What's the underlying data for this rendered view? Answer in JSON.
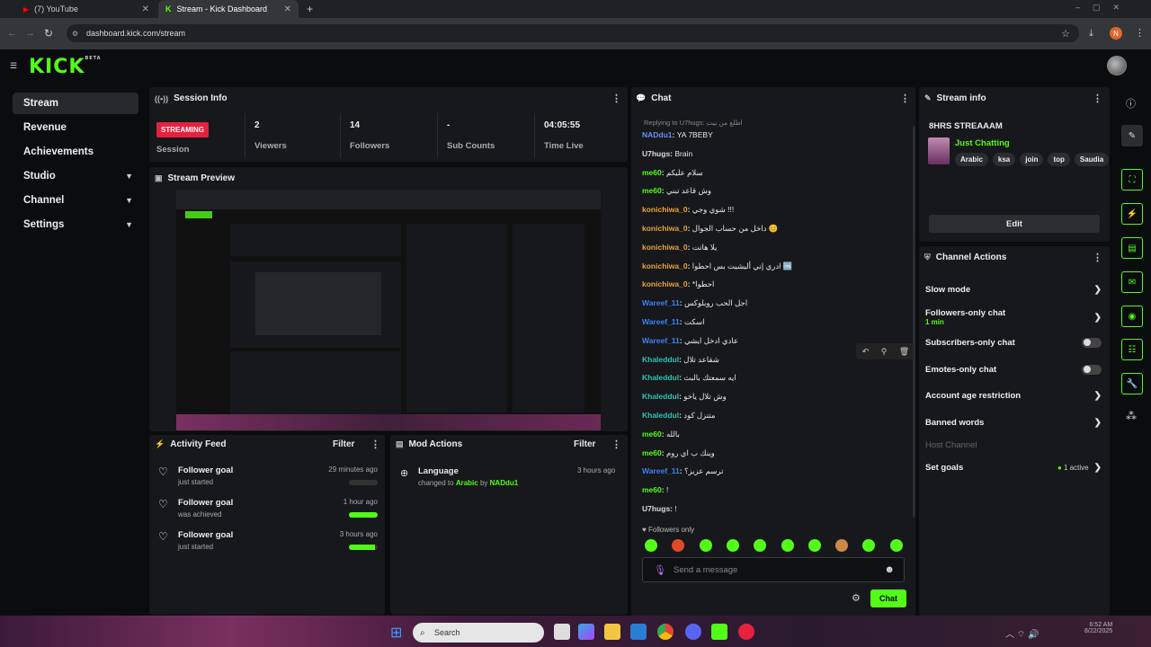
{
  "browser": {
    "tabs": [
      {
        "title": "(7) YouTube"
      },
      {
        "title": "Stream - Kick Dashboard"
      }
    ],
    "url": "dashboard.kick.com/stream",
    "profile_initial": "N"
  },
  "app": {
    "logo": "KICK",
    "logo_badge": "BETA"
  },
  "sidebar": {
    "items": [
      {
        "label": "Stream"
      },
      {
        "label": "Revenue"
      },
      {
        "label": "Achievements"
      },
      {
        "label": "Studio"
      },
      {
        "label": "Channel"
      },
      {
        "label": "Settings"
      }
    ]
  },
  "session": {
    "title": "Session Info",
    "status": "STREAMING",
    "status_label": "Session",
    "stats": [
      {
        "value": "2",
        "label": "Viewers"
      },
      {
        "value": "14",
        "label": "Followers"
      },
      {
        "value": "-",
        "label": "Sub Counts"
      },
      {
        "value": "04:05:55",
        "label": "Time Live"
      }
    ]
  },
  "preview": {
    "title": "Stream Preview"
  },
  "activity": {
    "title": "Activity Feed",
    "filter": "Filter",
    "items": [
      {
        "title": "Follower goal",
        "sub": "just started",
        "ago": "29 minutes ago",
        "progress": 0
      },
      {
        "title": "Follower goal",
        "sub": "was achieved",
        "ago": "1 hour ago",
        "progress": 1
      },
      {
        "title": "Follower goal",
        "sub": "just started",
        "ago": "3 hours ago",
        "progress": 0.9
      }
    ]
  },
  "mod": {
    "title": "Mod Actions",
    "filter": "Filter",
    "item": {
      "title": "Language",
      "prefix": "changed to",
      "lang": "Arabic",
      "by": "by",
      "user": "NADdu1",
      "ago": "3 hours ago"
    }
  },
  "chat": {
    "title": "Chat",
    "reply_to": "Replying to U7hugs: اطلع من بيت",
    "messages": [
      {
        "user": "NADdu1",
        "text": "YA 7BEBY",
        "color": "#6c8cff"
      },
      {
        "user": "U7hugs",
        "text": "Brain",
        "color": "#dddddd"
      },
      {
        "user": "me60",
        "text": "سلام عليكم",
        "color": "#53fc18"
      },
      {
        "user": "me60",
        "text": "وش قاعد تبني",
        "color": "#53fc18"
      },
      {
        "user": "konichiwa_0",
        "text": "شوي وجي !!!",
        "color": "#e8a33c"
      },
      {
        "user": "konichiwa_0",
        "text": "داخل من حساب الجوال 😊",
        "color": "#e8a33c"
      },
      {
        "user": "konichiwa_0",
        "text": "يلا هاتت",
        "color": "#e8a33c"
      },
      {
        "user": "konichiwa_0",
        "text": "ادري إني أليشيت بس احطوا 🆒",
        "color": "#e8a33c"
      },
      {
        "user": "konichiwa_0",
        "text": "*احطوا",
        "color": "#e8a33c"
      },
      {
        "user": "Wareef_11",
        "text": "اجل الحب روبلوكس",
        "color": "#3b82f6"
      },
      {
        "user": "Wareef_11",
        "text": "اسكت",
        "color": "#3b82f6"
      },
      {
        "user": "Wareef_11",
        "text": "عادي ادخل ايشي",
        "color": "#3b82f6"
      },
      {
        "user": "Khaleddul",
        "text": "شقاعد تلال",
        "color": "#2ec4b6"
      },
      {
        "user": "Khaleddul",
        "text": "ايه سمعتك بالبث",
        "color": "#2ec4b6"
      },
      {
        "user": "Khaleddul",
        "text": "وش تلال ياخو",
        "color": "#2ec4b6"
      },
      {
        "user": "Khaleddul",
        "text": "متنزل كود",
        "color": "#2ec4b6"
      },
      {
        "user": "me60",
        "text": "بالله",
        "color": "#53fc18"
      },
      {
        "user": "me60",
        "text": "وينك ب اي روم",
        "color": "#53fc18"
      },
      {
        "user": "Wareef_11",
        "text": "ترسم عزيز؟",
        "color": "#3b82f6"
      },
      {
        "user": "me60",
        "text": "!",
        "color": "#53fc18"
      },
      {
        "user": "U7hugs",
        "text": "!",
        "color": "#dddddd"
      }
    ],
    "mode": "Followers only",
    "placeholder": "Send a message",
    "send_label": "Chat"
  },
  "stream_info": {
    "title": "Stream info",
    "stream_title": "8HRS STREAAAM",
    "category": "Just Chatting",
    "tags": [
      "Arabic",
      "ksa",
      "join",
      "top",
      "Saudia"
    ],
    "edit_label": "Edit"
  },
  "actions": {
    "title": "Channel Actions",
    "items": [
      {
        "label": "Slow mode",
        "kind": "arrow"
      },
      {
        "label": "Followers-only chat",
        "sub": "1 min",
        "kind": "arrow"
      },
      {
        "label": "Subscribers-only chat",
        "kind": "toggle"
      },
      {
        "label": "Emotes-only chat",
        "kind": "toggle"
      },
      {
        "label": "Account age restriction",
        "kind": "arrow"
      },
      {
        "label": "Banned words",
        "kind": "arrow"
      },
      {
        "label": "Host Channel",
        "kind": "disabled"
      },
      {
        "label": "Set goals",
        "kind": "arrow",
        "status": "1 active"
      }
    ]
  },
  "taskbar": {
    "search": "Search",
    "time": "6:52 AM",
    "date": "8/22/2025"
  },
  "colors": {
    "accent": "#53fc18",
    "live": "#e5213e"
  }
}
